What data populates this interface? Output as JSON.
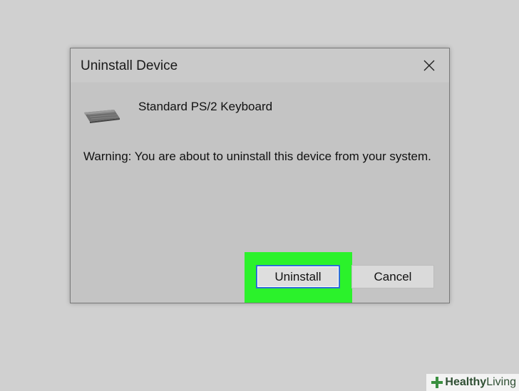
{
  "dialog": {
    "title": "Uninstall Device",
    "close_icon": "close-icon",
    "device_icon": "keyboard-icon",
    "device_name": "Standard PS/2 Keyboard",
    "warning": "Warning: You are about to uninstall this device from your system.",
    "uninstall_label": "Uninstall",
    "cancel_label": "Cancel"
  },
  "highlight_color": "#2bf22b",
  "watermark": {
    "brand_bold": "Healthy",
    "brand_light": "Living"
  }
}
